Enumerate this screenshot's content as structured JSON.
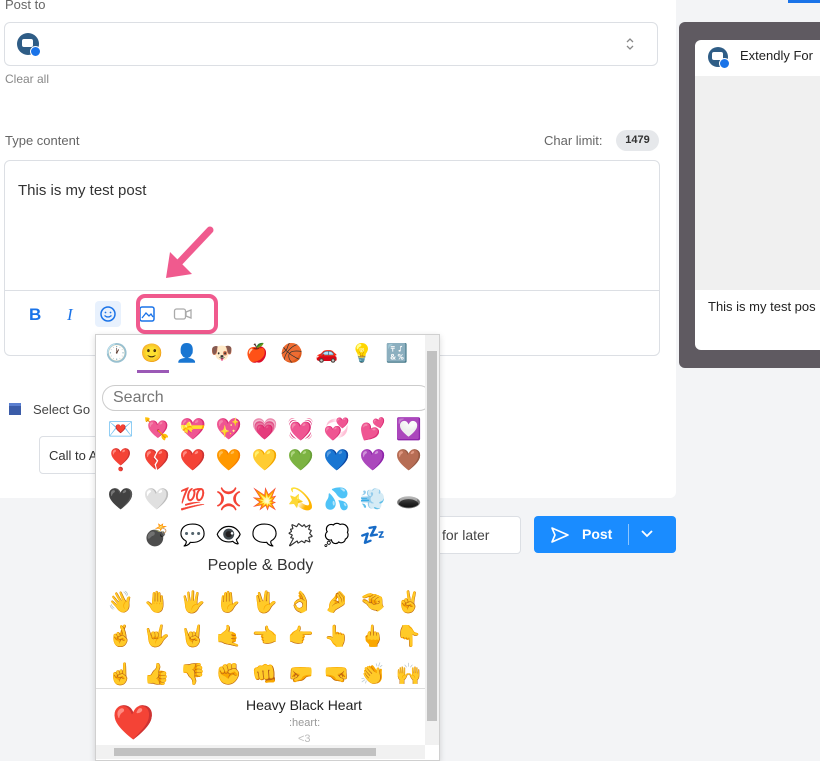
{
  "composer": {
    "post_to_label": "Post to",
    "clear_all": "Clear all",
    "type_content_label": "Type content",
    "char_limit_label": "Char limit:",
    "char_limit_value": "1479",
    "content_text": "This is my test post",
    "select_go_label": "Select Go",
    "call_to_label": "Call to A"
  },
  "toolbar": {
    "bold": "B",
    "italic": "I"
  },
  "picker": {
    "search_placeholder": "Search",
    "section_title": "People & Body",
    "preview_name": "Heavy Black Heart",
    "preview_code": ":heart:",
    "preview_alt": "<3",
    "categories": [
      "🕐",
      "🙂",
      "👤",
      "🐶",
      "🍎",
      "🏀",
      "🚗",
      "💡",
      "🔣",
      "🏁"
    ],
    "rows": [
      [
        "💌",
        "💘",
        "💝",
        "💖",
        "💗",
        "💓",
        "💞",
        "💕",
        "💟"
      ],
      [
        "❣️",
        "💔",
        "❤️",
        "🧡",
        "💛",
        "💚",
        "💙",
        "💜",
        "🤎"
      ],
      [
        "🖤",
        "🤍",
        "💯",
        "💢",
        "💥",
        "💫",
        "💦",
        "💨",
        "🕳️"
      ],
      [
        "",
        "💣",
        "💬",
        "👁️‍🗨️",
        "🗨️",
        "🗯️",
        "💭",
        "💤",
        ""
      ],
      [
        "👋",
        "🤚",
        "🖐️",
        "✋",
        "🖖",
        "👌",
        "🤌",
        "🤏",
        "✌️"
      ],
      [
        "🤞",
        "🤟",
        "🤘",
        "🤙",
        "👈",
        "👉",
        "👆",
        "🖕",
        "👇"
      ],
      [
        "☝️",
        "👍",
        "👎",
        "✊",
        "👊",
        "🤛",
        "🤜",
        "👏",
        "🙌"
      ]
    ],
    "preview_emoji": "❤️"
  },
  "preview": {
    "account_name": "Extendly For",
    "post_text": "This is my test pos"
  },
  "actions": {
    "later": "for later",
    "post": "Post"
  },
  "colors": {
    "accent": "#1a8cff",
    "highlight": "#f05a8e"
  }
}
